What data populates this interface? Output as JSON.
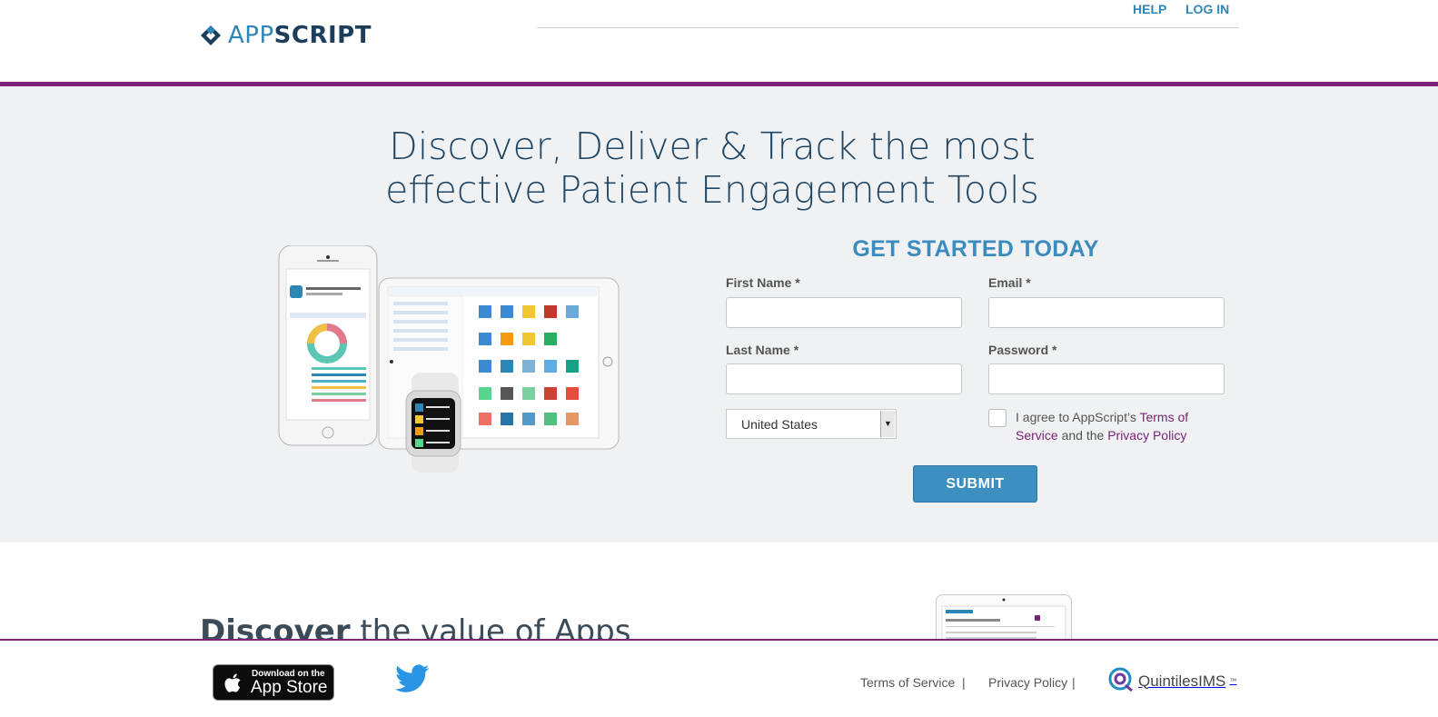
{
  "header": {
    "logo_app": "APP",
    "logo_script": "SCRIPT",
    "nav": {
      "help": "HELP",
      "login": "LOG IN"
    }
  },
  "hero": {
    "headline_line1": "Discover, Deliver & Track the most",
    "headline_line2": "effective Patient Engagement Tools"
  },
  "form": {
    "title": "GET STARTED TODAY",
    "first_name_label": "First Name *",
    "email_label": "Email *",
    "last_name_label": "Last Name *",
    "password_label": "Password *",
    "country_value": "United States",
    "agree_prefix": "I agree to AppScript’s ",
    "terms_link": "Terms of Service",
    "agree_mid": " and the ",
    "privacy_link": "Privacy Policy",
    "submit_label": "SUBMIT"
  },
  "section2": {
    "title_bold": "Discover",
    "title_rest": " the value of Apps"
  },
  "footer": {
    "appstore_small": "Download on the",
    "appstore_big": "App Store",
    "terms": "Terms of Service",
    "privacy": "Privacy Policy",
    "separator": "|",
    "partner": "QuintilesIMS",
    "partner_tm": "™"
  },
  "colors": {
    "brand_purple": "#7a2379",
    "brand_blue": "#3d8fbf",
    "headline_navy": "#1e4665",
    "hero_bg": "#f0f1f3"
  },
  "icons": [
    "appscript-logo-icon",
    "apple-icon",
    "twitter-icon",
    "quintiles-icon",
    "dropdown-arrow-icon"
  ]
}
